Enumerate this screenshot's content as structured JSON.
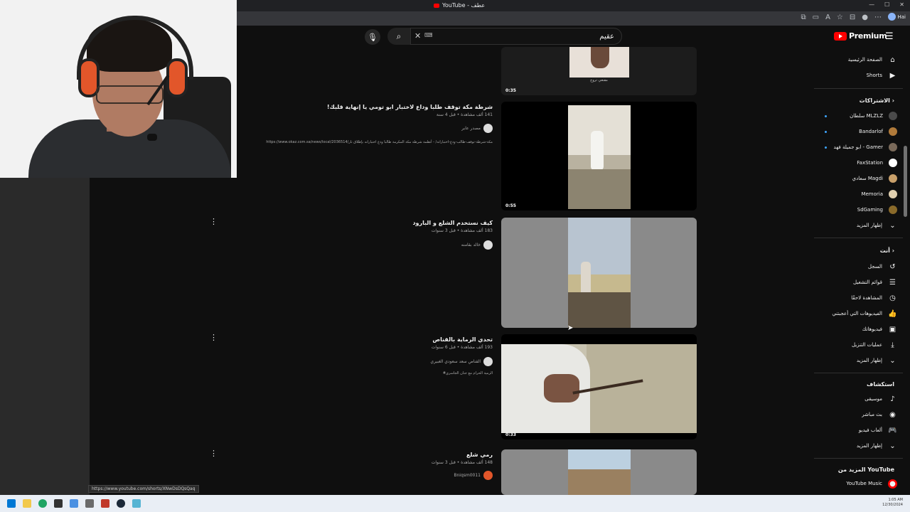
{
  "browser": {
    "tab_title": "YouTube - عطف",
    "profile": "Hai"
  },
  "search": {
    "query": "عقيم",
    "shortcut": "⌨"
  },
  "logo": {
    "text": "Premium"
  },
  "results": [
    {
      "title": "",
      "meta": "",
      "channel": "مقنعي تروح",
      "duration": "0:35",
      "desc": ""
    },
    {
      "title": "شرطة مكة توقف طلبا وداع لاختبار ابو تومي يا إنهاية قلبك!",
      "meta": "141 ألف مشاهدة • قبل 4 سنة",
      "channel": "مصدر عابر",
      "duration": "0:55",
      "desc": "https://www.okaz.com.sa/news/local/2036514/مكة-شرطة-توقف-طالب-ودع-اختباراته/ - أنظمة شرطة مكة المكرمة طالبا ودع اختباراته بإطلاق نار"
    },
    {
      "title": "كيف نستخدم الشلع و البارود",
      "meta": "183 ألف مشاهدة • قبل 3 سنوات",
      "channel": "خالد بقامنه",
      "duration": "",
      "desc": ""
    },
    {
      "title": "تحدي الرماية بالقناص",
      "meta": "193 ألف مشاهدة • قبل 6 سنوات",
      "channel": "القناص سعد سعودي الغبيري",
      "duration": "0:33",
      "desc": "#الرمية الحرام مع جنان الجاسري"
    },
    {
      "title": "رمي شلع",
      "meta": "148 ألف مشاهدة • قبل 3 سنوات",
      "channel": "Bniqsm0011",
      "duration": "",
      "desc": ""
    }
  ],
  "sidebar": {
    "top": [
      {
        "label": "الصفحة الرئيسية",
        "icon": "home-icon"
      },
      {
        "label": "Shorts",
        "icon": "shorts-icon"
      }
    ],
    "subscriptions_header": "الاشتراكات",
    "subscriptions": [
      {
        "label": "سلطان MLZLZ",
        "color": "#4a4a4a",
        "live": true
      },
      {
        "label": "Bandarlof",
        "color": "#b07a3a",
        "live": true
      },
      {
        "label": "ابو جميلة فهد - Gamer",
        "color": "#7a6a5a",
        "live": true
      },
      {
        "label": "FaxStation",
        "color": "#ffffff",
        "live": false
      },
      {
        "label": "سعادي Magdi",
        "color": "#c9a06a",
        "live": false
      },
      {
        "label": "Memoria",
        "color": "#e0d0b0",
        "live": false
      },
      {
        "label": "SdGaming",
        "color": "#8a6a2a",
        "live": false
      },
      {
        "label": "إظهار المزيد",
        "color": "",
        "live": false
      }
    ],
    "you_header": "أنت",
    "you": [
      {
        "label": "السجل",
        "icon": "history-icon"
      },
      {
        "label": "قوائم التشغيل",
        "icon": "playlist-icon"
      },
      {
        "label": "المشاهدة لاحقًا",
        "icon": "clock-icon"
      },
      {
        "label": "الفيديوهات التي أعجبتني",
        "icon": "thumbs-up-icon"
      },
      {
        "label": "فيديوهاتك",
        "icon": "video-icon"
      },
      {
        "label": "عمليات التنزيل",
        "icon": "download-icon"
      },
      {
        "label": "إظهار المزيد",
        "icon": "chevron-down-icon"
      }
    ],
    "explore_header": "استكشاف",
    "explore": [
      {
        "label": "موسيقى",
        "icon": "music-icon"
      },
      {
        "label": "بث مباشر",
        "icon": "live-icon"
      },
      {
        "label": "ألعاب فيديو",
        "icon": "gaming-icon"
      },
      {
        "label": "إظهار المزيد",
        "icon": "chevron-down-icon"
      }
    ],
    "more_header": "المزيد من YouTube",
    "more": [
      {
        "label": "YouTube Music",
        "icon": "yt-music-icon"
      }
    ]
  },
  "status_url": "https://www.youtube.com/shorts/XNwDsDQsQaq",
  "tray": {
    "time": "1:05 AM",
    "date": "12/30/2024"
  },
  "colors": {
    "accent": "#ff0000",
    "background": "#0f0f0f",
    "link": "#3ea6ff"
  }
}
